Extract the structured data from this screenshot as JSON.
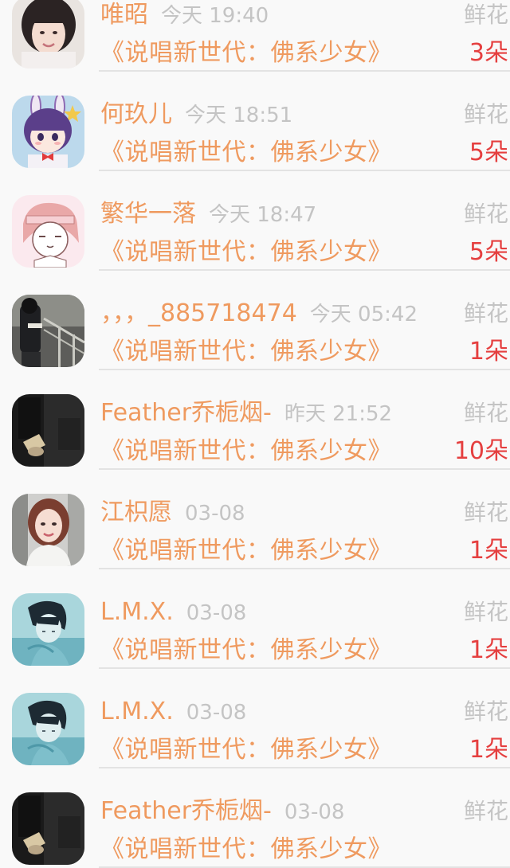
{
  "gift_records": [
    {
      "name": "唯昭",
      "time": "今天 19:40",
      "work": "《说唱新世代：佛系少女》",
      "gift_type": "鲜花",
      "count": "3朵",
      "avatar_icon": "girl-portrait-avatar"
    },
    {
      "name": "何玖儿",
      "time": "今天 18:51",
      "work": "《说唱新世代：佛系少女》",
      "gift_type": "鲜花",
      "count": "5朵",
      "avatar_icon": "anime-bunny-girl-avatar"
    },
    {
      "name": "繁华一落",
      "time": "今天 18:47",
      "work": "《说唱新世代：佛系少女》",
      "gift_type": "鲜花",
      "count": "5朵",
      "avatar_icon": "cartoon-girl-sketch-avatar"
    },
    {
      "name": "，，，_885718474",
      "time": "今天 05:42",
      "work": "《说唱新世代：佛系少女》",
      "gift_type": "鲜花",
      "count": "1朵",
      "avatar_icon": "dark-railing-photo-avatar"
    },
    {
      "name": "Feather乔栀烟-",
      "time": "昨天 21:52",
      "work": "《说唱新世代：佛系少女》",
      "gift_type": "鲜花",
      "count": "10朵",
      "avatar_icon": "dark-hands-book-avatar"
    },
    {
      "name": "江枳愿",
      "time": "03-08",
      "work": "《说唱新世代：佛系少女》",
      "gift_type": "鲜花",
      "count": "1朵",
      "avatar_icon": "woman-portrait-avatar"
    },
    {
      "name": "L.M.X.",
      "time": "03-08",
      "work": "《说唱新世代：佛系少女》",
      "gift_type": "鲜花",
      "count": "1朵",
      "avatar_icon": "teal-illustrated-boy-avatar"
    },
    {
      "name": "L.M.X.",
      "time": "03-08",
      "work": "《说唱新世代：佛系少女》",
      "gift_type": "鲜花",
      "count": "1朵",
      "avatar_icon": "teal-illustrated-boy-avatar"
    },
    {
      "name": "Feather乔栀烟-",
      "time": "03-08",
      "work": "《说唱新世代：佛系少女》",
      "gift_type": "鲜花",
      "count": "",
      "avatar_icon": "dark-hands-book-avatar"
    }
  ],
  "colors": {
    "name": "#ef9a5f",
    "time": "#c4c4c4",
    "count": "#e53f3f",
    "divider": "#e3e3e3",
    "background": "#f9f9f9"
  }
}
